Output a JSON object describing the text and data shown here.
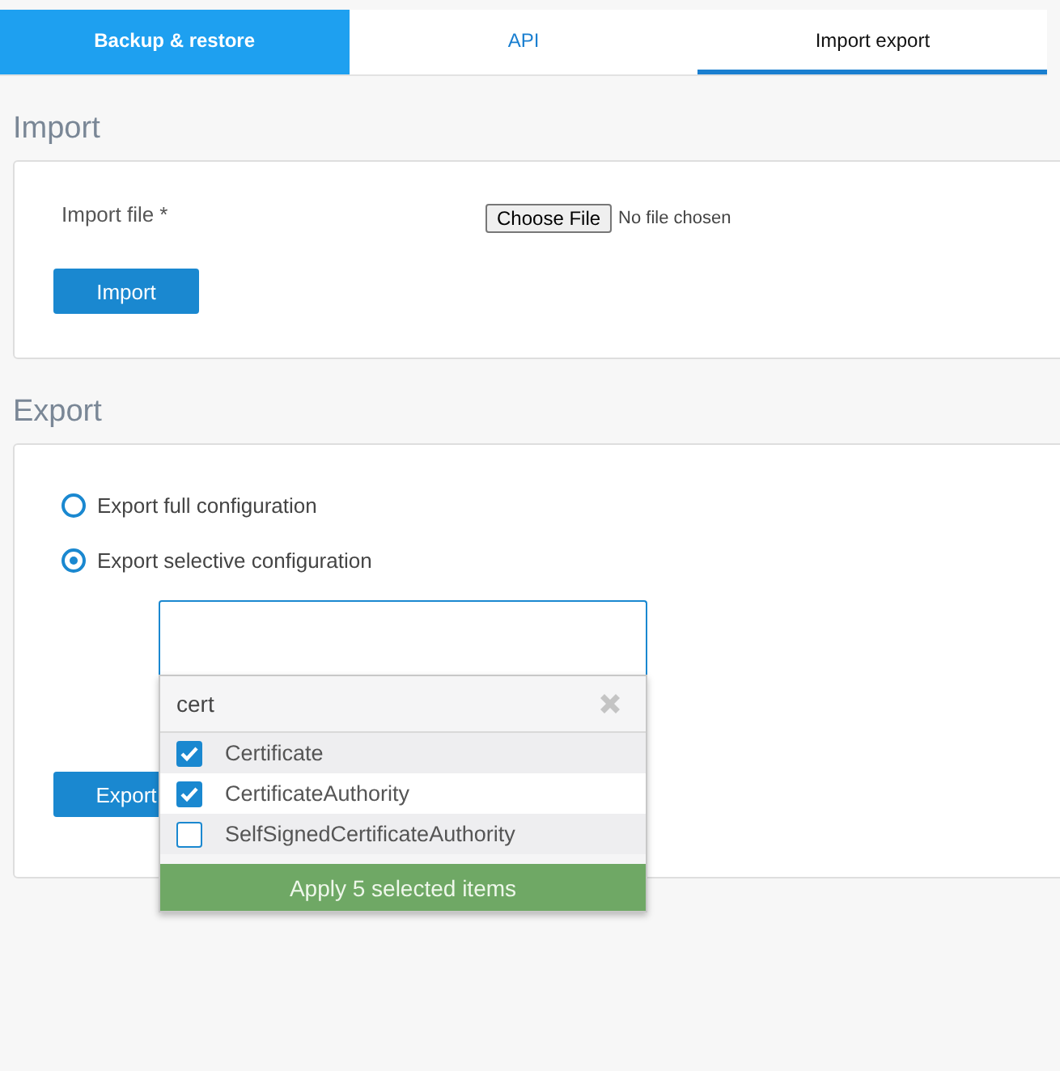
{
  "tabs": [
    {
      "label": "Backup & restore",
      "highlighted": true,
      "selected": false
    },
    {
      "label": "API",
      "highlighted": false,
      "selected": false
    },
    {
      "label": "Import export",
      "highlighted": false,
      "selected": true
    }
  ],
  "import": {
    "heading": "Import",
    "file_label": "Import file *",
    "choose_button": "Choose File",
    "file_status": "No file chosen",
    "button": "Import"
  },
  "export": {
    "heading": "Export",
    "options": [
      {
        "label": "Export full configuration",
        "selected": false
      },
      {
        "label": "Export selective configuration",
        "selected": true
      }
    ],
    "button": "Export",
    "picker": {
      "search": "cert",
      "items": [
        {
          "label": "Certificate",
          "checked": true,
          "hovered": false
        },
        {
          "label": "CertificateAuthority",
          "checked": true,
          "hovered": true
        },
        {
          "label": "SelfSignedCertificateAuthority",
          "checked": false,
          "hovered": false
        }
      ],
      "apply": "Apply 5 selected items"
    }
  }
}
